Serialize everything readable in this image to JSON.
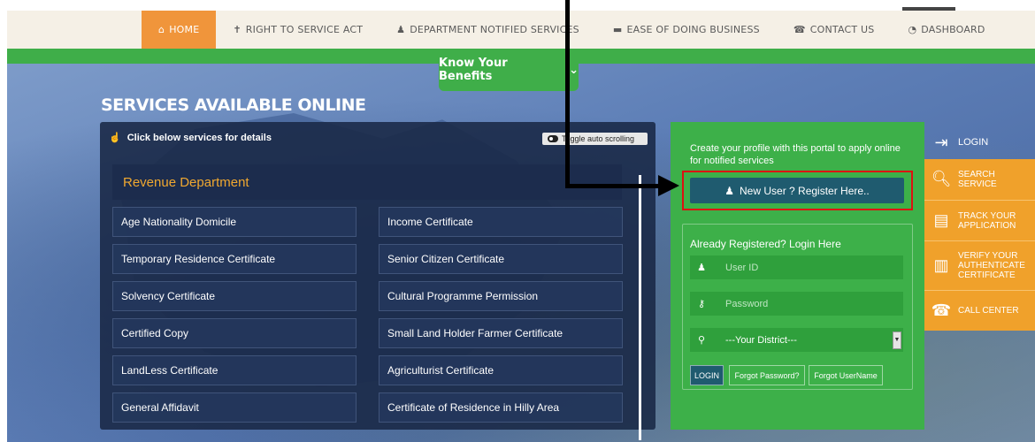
{
  "nav": {
    "items": [
      {
        "icon": "home-icon",
        "glyph": "❀",
        "label": "HOME",
        "active": true
      },
      {
        "icon": "gavel-icon",
        "glyph": "✝",
        "label": "RIGHT TO SERVICE ACT",
        "active": false
      },
      {
        "icon": "user-icon",
        "glyph": "♟",
        "label": "DEPARTMENT NOTIFIED SERVICES",
        "active": false
      },
      {
        "icon": "briefcase-icon",
        "glyph": "▬",
        "label": "EASE OF DOING BUSINESS",
        "active": false
      },
      {
        "icon": "phone-icon",
        "glyph": "☎",
        "label": "CONTACT US",
        "active": false
      },
      {
        "icon": "dashboard-icon",
        "glyph": "◔",
        "label": "DASHBOARD",
        "active": false
      }
    ]
  },
  "benefits": {
    "label": "Know Your Benefits",
    "chevron": "⌄"
  },
  "services": {
    "heading": "SERVICES AVAILABLE ONLINE",
    "hint": "Click below services for details",
    "toggle_label": "Toggle auto scrolling",
    "department": "Revenue Department",
    "left_column": [
      "Age Nationality Domicile",
      "Temporary Residence Certificate",
      "Solvency Certificate",
      "Certified Copy",
      "LandLess Certificate",
      "General Affidavit"
    ],
    "right_column": [
      "Income Certificate",
      "Senior Citizen Certificate",
      "Cultural Programme Permission",
      "Small Land Holder Farmer Certificate",
      "Agriculturist Certificate",
      "Certificate of Residence in Hilly Area"
    ]
  },
  "login_panel": {
    "profile_text": "Create your profile with this portal to apply online for notified services",
    "register_label": "New User ? Register Here..",
    "login_title": "Already Registered? Login Here",
    "userid_placeholder": "User ID",
    "password_placeholder": "Password",
    "district_selected": "---Your District---",
    "login_btn": "LOGIN",
    "forgot_password": "Forgot Password?",
    "forgot_username": "Forgot UserName"
  },
  "side_menu": {
    "login": "LOGIN",
    "search": "SEARCH SERVICE",
    "track": "TRACK YOUR APPLICATION",
    "verify": "VERIFY YOUR AUTHENTICATE CERTIFICATE",
    "call": "CALL CENTER"
  },
  "colors": {
    "accent_orange": "#f0953b",
    "green": "#3fae49",
    "dept_text": "#f0a830",
    "register_btn": "#1f5b6f"
  }
}
